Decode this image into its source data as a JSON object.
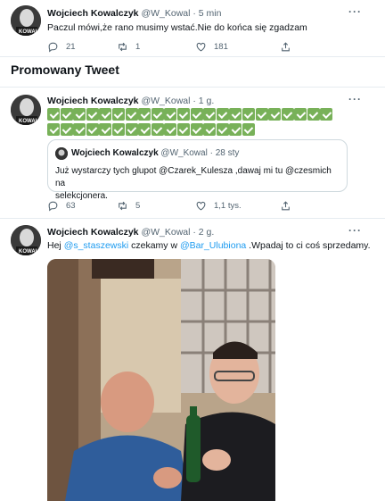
{
  "tweet1": {
    "name": "Wojciech Kowalczyk",
    "handle_time": "@W_Kowal · 5 min",
    "text": "Paczul mówi,że rano musimy wstać.Nie do końca się zgadzam",
    "replies": "21",
    "retweets": "1",
    "likes": "181"
  },
  "promoted": {
    "title": "Promowany Tweet"
  },
  "tweet2": {
    "name": "Wojciech Kowalczyk",
    "handle_time": "@W_Kowal · 1 g.",
    "check_count": 38,
    "quote": {
      "name": "Wojciech Kowalczyk",
      "handle_time": "@W_Kowal · 28 sty",
      "text_part1": "Już wystarczy tych glupot @Czarek_Kulesza ,dawaj mi tu @czesmich  na",
      "text_part2": "selekcjonera."
    },
    "replies": "63",
    "retweets": "5",
    "likes": "1,1 tys."
  },
  "tweet3": {
    "name": "Wojciech Kowalczyk",
    "handle_time": "@W_Kowal · 2 g.",
    "text_before": "Hej ",
    "mention1": "@s_staszewski",
    "text_mid": " czekamy w ",
    "mention2": "@Bar_Ulubiona",
    "text_after": " .Wpadaj to ci coś sprzedamy."
  },
  "more_label": "···",
  "icons": {
    "reply": "reply-icon",
    "retweet": "retweet-icon",
    "like": "heart-icon",
    "share": "share-icon"
  },
  "colors": {
    "link": "#1d9bf0",
    "check": "#78b159",
    "muted": "#536471"
  }
}
